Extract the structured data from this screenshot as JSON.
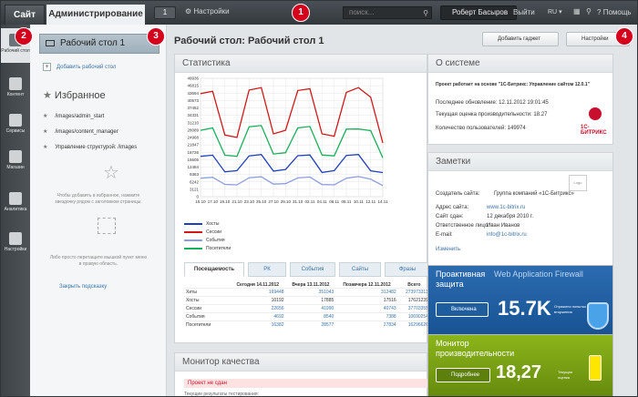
{
  "topbar": {
    "tab_site": "Сайт",
    "tab_admin": "Администрирование",
    "notifications": "1",
    "settings": "Настройки",
    "search_placeholder": "поиск...",
    "user": "Роберт Басыров",
    "exit": "Выйти",
    "lang": "RU",
    "help": "Помощь"
  },
  "rail": [
    {
      "label": "Рабочий стол",
      "icon": "home-icon"
    },
    {
      "label": "Контент",
      "icon": "document-icon"
    },
    {
      "label": "Сервисы",
      "icon": "services-icon"
    },
    {
      "label": "Магазин",
      "icon": "cart-icon"
    },
    {
      "label": "Аналитика",
      "icon": "analytics-icon"
    },
    {
      "label": "Настройки",
      "icon": "gear-icon"
    }
  ],
  "sidebar": {
    "desktop": "Рабочий стол 1",
    "add_desktop": "Добавить рабочий стол",
    "favorites_title": "Избранное",
    "favorites": [
      "/images/admin_start",
      "/images/content_manager",
      "Управление структурой: /images"
    ],
    "hint1": "Чтобы добавить в избранное, нажмите звездочку рядом с заголовком страницы.",
    "hint2": "Либо просто перетащите мышкой пункт меню в правую область.",
    "hint_link": "Закрыть подсказку"
  },
  "main": {
    "title": "Рабочий стол: Рабочий стол 1",
    "add_gadget": "Добавить гаджет",
    "settings_btn": "Настройки"
  },
  "stats": {
    "title": "Статистика",
    "tabs": [
      "Посещаемость",
      "РК",
      "События",
      "Сайты",
      "Фразы"
    ],
    "columns": [
      "",
      "Сегодня 14.11.2012",
      "Вчера 13.11.2012",
      "Позавчера 12.11.2012",
      "Всего"
    ],
    "rows": [
      {
        "label": "Хиты",
        "today": "169448",
        "yesterday": "351043",
        "before": "312482",
        "total": "273973313"
      },
      {
        "label": "Хосты",
        "today": "10192",
        "yesterday": "17885",
        "before": "17516",
        "total": "17621239"
      },
      {
        "label": "Сессии",
        "today": "22656",
        "yesterday": "41990",
        "before": "40743",
        "total": "37703355"
      },
      {
        "label": "События",
        "today": "4692",
        "yesterday": "8540",
        "before": "7388",
        "total": "10690254"
      },
      {
        "label": "Посетители",
        "today": "16382",
        "yesterday": "28577",
        "before": "27834",
        "total": "16296626"
      }
    ]
  },
  "chart_data": {
    "type": "line",
    "ylim": [
      0,
      49936
    ],
    "yticks": [
      "49936",
      "46815",
      "43694",
      "40573",
      "37452",
      "34331",
      "31210",
      "28089",
      "24968",
      "21847",
      "18726",
      "15605",
      "12484",
      "9363",
      "6242",
      "3121",
      "0"
    ],
    "xticks": [
      "15.10",
      "17.10",
      "19.10",
      "21.10",
      "23.10",
      "25.10",
      "27.10",
      "29.10",
      "31.10",
      "02.11",
      "04.11",
      "06.11",
      "08.11",
      "10.11",
      "12.11",
      "14.11"
    ],
    "series": [
      {
        "name": "Хосты",
        "color": "#1f3fb8",
        "values": [
          17000,
          17500,
          10500,
          11000,
          17200,
          17800,
          10800,
          11500,
          17300,
          17600,
          10200,
          11000,
          17400,
          17800,
          10900,
          10192
        ]
      },
      {
        "name": "Сессии",
        "color": "#d01818",
        "values": [
          43500,
          44500,
          26000,
          25000,
          45000,
          46000,
          26500,
          28000,
          44800,
          45500,
          26500,
          25500,
          44000,
          46000,
          41990,
          22656
        ]
      },
      {
        "name": "События",
        "color": "#8c9ee0",
        "values": [
          7800,
          8200,
          5200,
          5000,
          8000,
          8400,
          5300,
          5500,
          7900,
          8300,
          5100,
          5000,
          7800,
          8500,
          7388,
          4692
        ]
      },
      {
        "name": "Посетители",
        "color": "#18b05a",
        "values": [
          28000,
          29000,
          17500,
          17000,
          29500,
          30000,
          18000,
          18500,
          29000,
          29600,
          17600,
          17200,
          28500,
          28577,
          27834,
          16382
        ]
      }
    ]
  },
  "system": {
    "title": "О системе",
    "project": "Проект работает на основе \"1С-Битрикс: Управление сайтом 12.0.1\"",
    "updated": "Последнее обновление: 12.11.2012 19:01:45",
    "perf": "Текущая оценка производительности: 18.27",
    "users": "Количество пользователей: 149974",
    "logo": "1С-БИТРИКС"
  },
  "notes": {
    "title": "Заметки",
    "rows": [
      {
        "k": "Создатель сайта:",
        "v": "Группа компаний «1С-Битрикс»"
      },
      {
        "k": "Адрес сайта:",
        "v": "www.1c-bitrix.ru"
      },
      {
        "k": "Сайт сдан:",
        "v": "12 декабря 2010 г."
      },
      {
        "k": "Ответственное лицо:",
        "v": "Иван Иванов"
      },
      {
        "k": "E-mail:",
        "v": "info@1c-bitrix.ru"
      }
    ],
    "logo": "Logo",
    "edit": "Изменить"
  },
  "proactive": {
    "title": "Проактивная защита",
    "subtitle": "Web Application Firewall",
    "button": "Включена",
    "count": "15.7K",
    "caption": "Отражено попыток вторжения"
  },
  "perfmon": {
    "title": "Монитор производительности",
    "button": "Подробнее",
    "value": "18,27",
    "caption": "Текущая оценка"
  },
  "quality": {
    "title": "Монитор качества",
    "status": "Проект не сдан",
    "sub": "Текущие результаты тестирования:"
  },
  "markers": [
    "1",
    "2",
    "3",
    "4"
  ]
}
